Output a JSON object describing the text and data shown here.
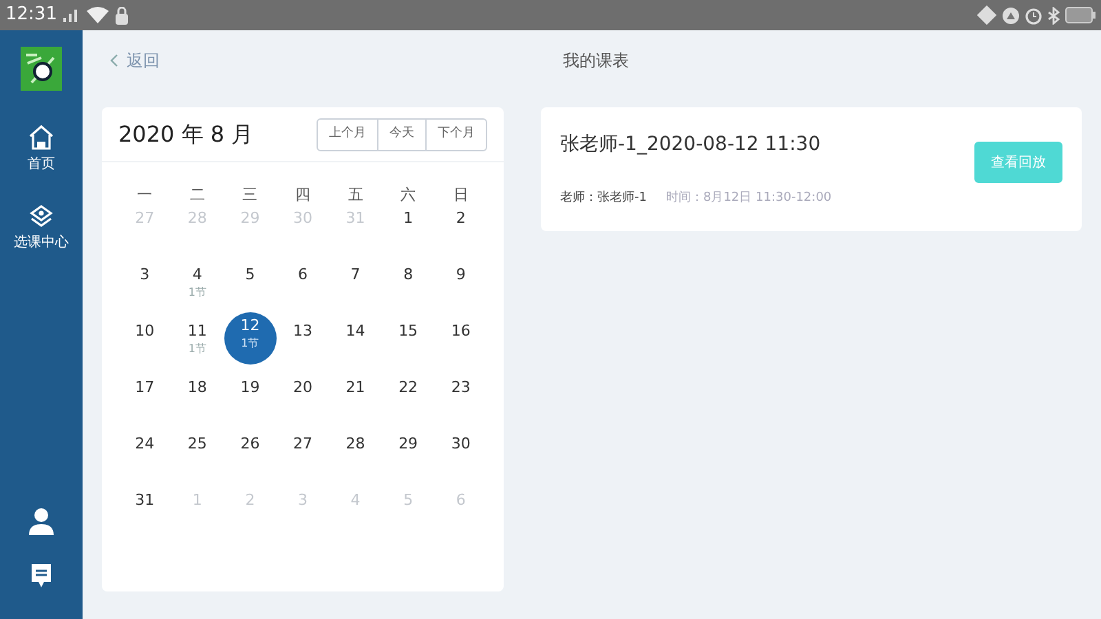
{
  "status_bar": {
    "time": "12:31"
  },
  "sidebar": {
    "items": [
      {
        "kind": "home",
        "label": "首页"
      },
      {
        "kind": "courses",
        "label": "选课中心"
      }
    ],
    "bottom": [
      {
        "kind": "user"
      },
      {
        "kind": "message"
      }
    ]
  },
  "header": {
    "back": "返回",
    "title": "我的课表"
  },
  "calendar": {
    "month": "2020 年 8 月",
    "nav": [
      "上个月",
      "今天",
      "下个月"
    ],
    "weekdays": [
      "一",
      "二",
      "三",
      "四",
      "五",
      "六",
      "日"
    ],
    "days": [
      {
        "label": "27",
        "muted": true,
        "selected": false
      },
      {
        "label": "28",
        "muted": true,
        "selected": false
      },
      {
        "label": "29",
        "muted": true,
        "selected": false
      },
      {
        "label": "30",
        "muted": true,
        "selected": false
      },
      {
        "label": "31",
        "muted": true,
        "selected": false
      },
      {
        "label": "1",
        "muted": false,
        "selected": false
      },
      {
        "label": "2",
        "muted": false,
        "selected": false
      },
      {
        "label": "3",
        "muted": false,
        "selected": false
      },
      {
        "label": "4",
        "muted": false,
        "selected": false,
        "note": "1节"
      },
      {
        "label": "5",
        "muted": false,
        "selected": false
      },
      {
        "label": "6",
        "muted": false,
        "selected": false
      },
      {
        "label": "7",
        "muted": false,
        "selected": false
      },
      {
        "label": "8",
        "muted": false,
        "selected": false
      },
      {
        "label": "9",
        "muted": false,
        "selected": false
      },
      {
        "label": "10",
        "muted": false,
        "selected": false
      },
      {
        "label": "11",
        "muted": false,
        "selected": false,
        "note": "1节"
      },
      {
        "label": "12",
        "muted": false,
        "selected": true,
        "note": "1节"
      },
      {
        "label": "13",
        "muted": false,
        "selected": false
      },
      {
        "label": "14",
        "muted": false,
        "selected": false
      },
      {
        "label": "15",
        "muted": false,
        "selected": false
      },
      {
        "label": "16",
        "muted": false,
        "selected": false
      },
      {
        "label": "17",
        "muted": false,
        "selected": false
      },
      {
        "label": "18",
        "muted": false,
        "selected": false
      },
      {
        "label": "19",
        "muted": false,
        "selected": false
      },
      {
        "label": "20",
        "muted": false,
        "selected": false
      },
      {
        "label": "21",
        "muted": false,
        "selected": false
      },
      {
        "label": "22",
        "muted": false,
        "selected": false
      },
      {
        "label": "23",
        "muted": false,
        "selected": false
      },
      {
        "label": "24",
        "muted": false,
        "selected": false
      },
      {
        "label": "25",
        "muted": false,
        "selected": false
      },
      {
        "label": "26",
        "muted": false,
        "selected": false
      },
      {
        "label": "27",
        "muted": false,
        "selected": false
      },
      {
        "label": "28",
        "muted": false,
        "selected": false
      },
      {
        "label": "29",
        "muted": false,
        "selected": false
      },
      {
        "label": "30",
        "muted": false,
        "selected": false
      },
      {
        "label": "31",
        "muted": false,
        "selected": false
      },
      {
        "label": "1",
        "muted": true,
        "selected": false
      },
      {
        "label": "2",
        "muted": true,
        "selected": false
      },
      {
        "label": "3",
        "muted": true,
        "selected": false
      },
      {
        "label": "4",
        "muted": true,
        "selected": false
      },
      {
        "label": "5",
        "muted": true,
        "selected": false
      },
      {
        "label": "6",
        "muted": true,
        "selected": false
      }
    ]
  },
  "lessons": [
    {
      "title": "张老师-1_2020-08-12 11:30",
      "teacher": "老师：张老师-1",
      "time": "时间：8月12日 11:30-12:00",
      "button": "查看回放"
    }
  ]
}
